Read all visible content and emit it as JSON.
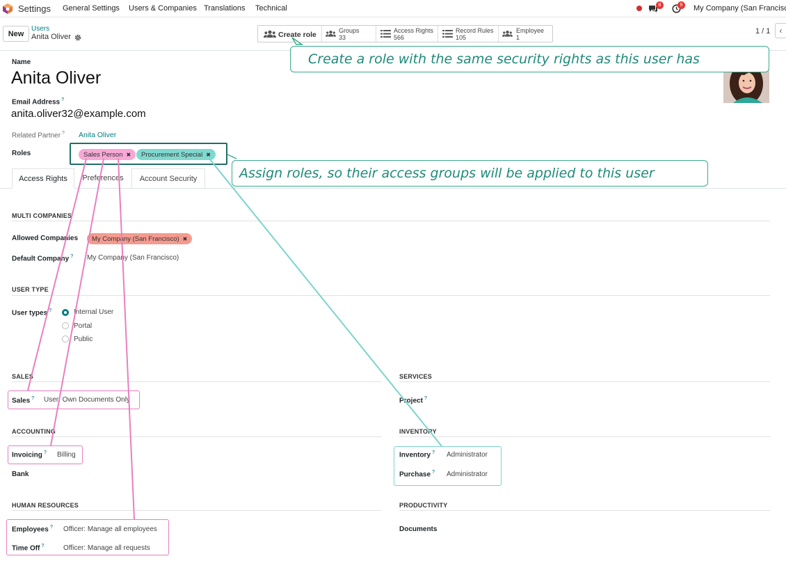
{
  "topnav": {
    "app_title": "Settings",
    "menu": [
      "General Settings",
      "Users & Companies",
      "Translations",
      "Technical"
    ],
    "chat_badge": "8",
    "activity_badge": "9",
    "company": "My Company (San Francisco)"
  },
  "control_panel": {
    "new_label": "New",
    "breadcrumb_parent": "Users",
    "breadcrumb_current": "Anita Oliver",
    "create_role_label": "Create role",
    "smart_buttons": [
      {
        "label": "Groups",
        "value": "33"
      },
      {
        "label": "Access Rights",
        "value": "566"
      },
      {
        "label": "Record Rules",
        "value": "105"
      },
      {
        "label": "Employee",
        "value": "1"
      }
    ],
    "pager": "1 / 1"
  },
  "form": {
    "name_label": "Name",
    "name_value": "Anita Oliver",
    "email_label": "Email Address",
    "email_value": "anita.oliver32@example.com",
    "partner_label": "Related Partner",
    "partner_value": "Anita Oliver",
    "roles_label": "Roles",
    "roles": [
      "Sales Person",
      "Procurement Special"
    ],
    "tabs": [
      "Access Rights",
      "Preferences",
      "Account Security"
    ]
  },
  "access": {
    "multi_companies_title": "MULTI COMPANIES",
    "allowed_companies_label": "Allowed Companies",
    "allowed_companies_tag": "My Company (San Francisco)",
    "default_company_label": "Default Company",
    "default_company_value": "My Company (San Francisco)",
    "user_type_title": "USER TYPE",
    "user_types_label": "User types",
    "user_type_options": [
      "Internal User",
      "Portal",
      "Public"
    ],
    "sales_title": "SALES",
    "sales_label": "Sales",
    "sales_value": "User: Own Documents Only",
    "services_title": "SERVICES",
    "project_label": "Project",
    "accounting_title": "ACCOUNTING",
    "invoicing_label": "Invoicing",
    "invoicing_value": "Billing",
    "bank_label": "Bank",
    "inventory_title": "INVENTORY",
    "inventory_label": "Inventory",
    "inventory_value": "Administrator",
    "purchase_label": "Purchase",
    "purchase_value": "Administrator",
    "hr_title": "HUMAN RESOURCES",
    "employees_label": "Employees",
    "employees_value": "Officer: Manage all employees",
    "timeoff_label": "Time Off",
    "timeoff_value": "Officer: Manage all requests",
    "productivity_title": "PRODUCTIVITY",
    "documents_label": "Documents"
  },
  "callouts": {
    "create_role": "Create a role with the same security rights as this user has",
    "assign_roles": "Assign roles, so their access groups will be applied to this user"
  },
  "colors": {
    "sales_person_tag": "#f7a8d6",
    "procurement_tag": "#7fd9cf",
    "company_tag": "#f59a8f",
    "pink_annotation": "#e87fbf",
    "teal_annotation": "#7ad4cc",
    "callout_text": "#1e8a7a"
  }
}
